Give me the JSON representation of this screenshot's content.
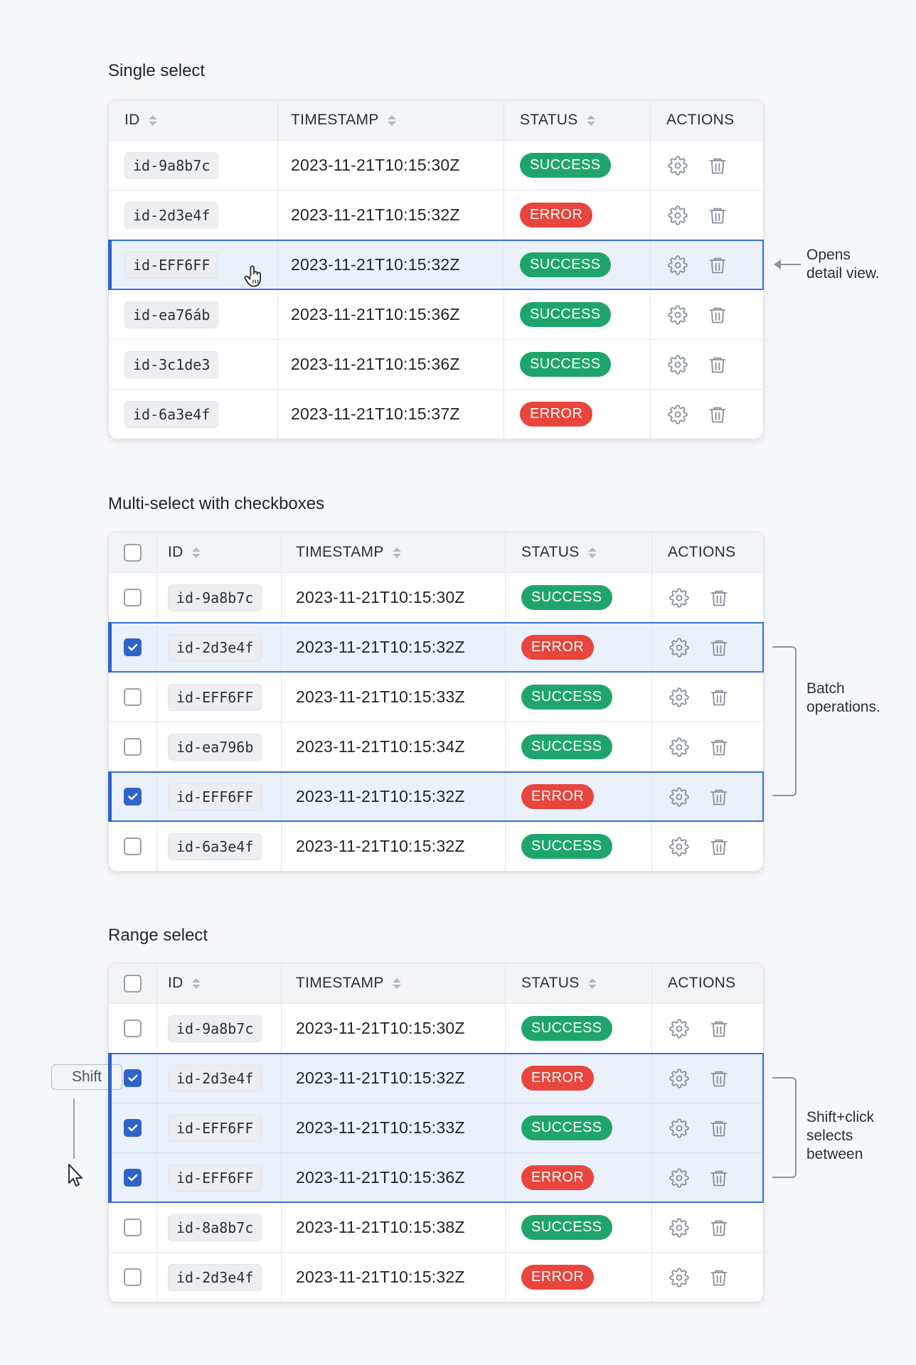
{
  "colors": {
    "success": "#1fa56b",
    "error": "#e8453c",
    "selection_border": "#3b6fd4",
    "selection_bg": "#eaf1fb"
  },
  "headers": {
    "id": "ID",
    "timestamp": "TIMESTAMP",
    "status": "STATUS",
    "actions": "ACTIONS"
  },
  "single": {
    "title": "Single select",
    "rows": [
      {
        "id": "id-9a8b7c",
        "ts": "2023-11-21T10:15:30Z",
        "status": "SUCCESS"
      },
      {
        "id": "id-2d3e4f",
        "ts": "2023-11-21T10:15:32Z",
        "status": "ERROR"
      },
      {
        "id": "id-EFF6FF",
        "ts": "2023-11-21T10:15:32Z",
        "status": "SUCCESS"
      },
      {
        "id": "id-ea76áb",
        "ts": "2023-11-21T10:15:36Z",
        "status": "SUCCESS"
      },
      {
        "id": "id-3c1de3",
        "ts": "2023-11-21T10:15:36Z",
        "status": "SUCCESS"
      },
      {
        "id": "id-6a3e4f",
        "ts": "2023-11-21T10:15:37Z",
        "status": "ERROR"
      }
    ],
    "annotation": [
      "Opens",
      "detail view."
    ]
  },
  "multi": {
    "title": "Multi-select with checkboxes",
    "rows": [
      {
        "id": "id-9a8b7c",
        "ts": "2023-11-21T10:15:30Z",
        "status": "SUCCESS"
      },
      {
        "id": "id-2d3e4f",
        "ts": "2023-11-21T10:15:32Z",
        "status": "ERROR"
      },
      {
        "id": "id-EFF6FF",
        "ts": "2023-11-21T10:15:33Z",
        "status": "SUCCESS"
      },
      {
        "id": "id-ea796b",
        "ts": "2023-11-21T10:15:34Z",
        "status": "SUCCESS"
      },
      {
        "id": "id-EFF6FF",
        "ts": "2023-11-21T10:15:32Z",
        "status": "ERROR"
      },
      {
        "id": "id-6a3e4f",
        "ts": "2023-11-21T10:15:32Z",
        "status": "SUCCESS"
      }
    ],
    "annotation": [
      "Batch",
      "operations."
    ]
  },
  "range": {
    "title": "Range select",
    "rows": [
      {
        "id": "id-9a8b7c",
        "ts": "2023-11-21T10:15:30Z",
        "status": "SUCCESS"
      },
      {
        "id": "id-2d3e4f",
        "ts": "2023-11-21T10:15:32Z",
        "status": "ERROR"
      },
      {
        "id": "id-EFF6FF",
        "ts": "2023-11-21T10:15:33Z",
        "status": "SUCCESS"
      },
      {
        "id": "id-EFF6FF",
        "ts": "2023-11-21T10:15:36Z",
        "status": "ERROR"
      },
      {
        "id": "id-8a8b7c",
        "ts": "2023-11-21T10:15:38Z",
        "status": "SUCCESS"
      },
      {
        "id": "id-2d3e4f",
        "ts": "2023-11-21T10:15:32Z",
        "status": "ERROR"
      }
    ],
    "annotation": [
      "Shift+click",
      "selects",
      "between"
    ],
    "shift_key": "Shift"
  }
}
